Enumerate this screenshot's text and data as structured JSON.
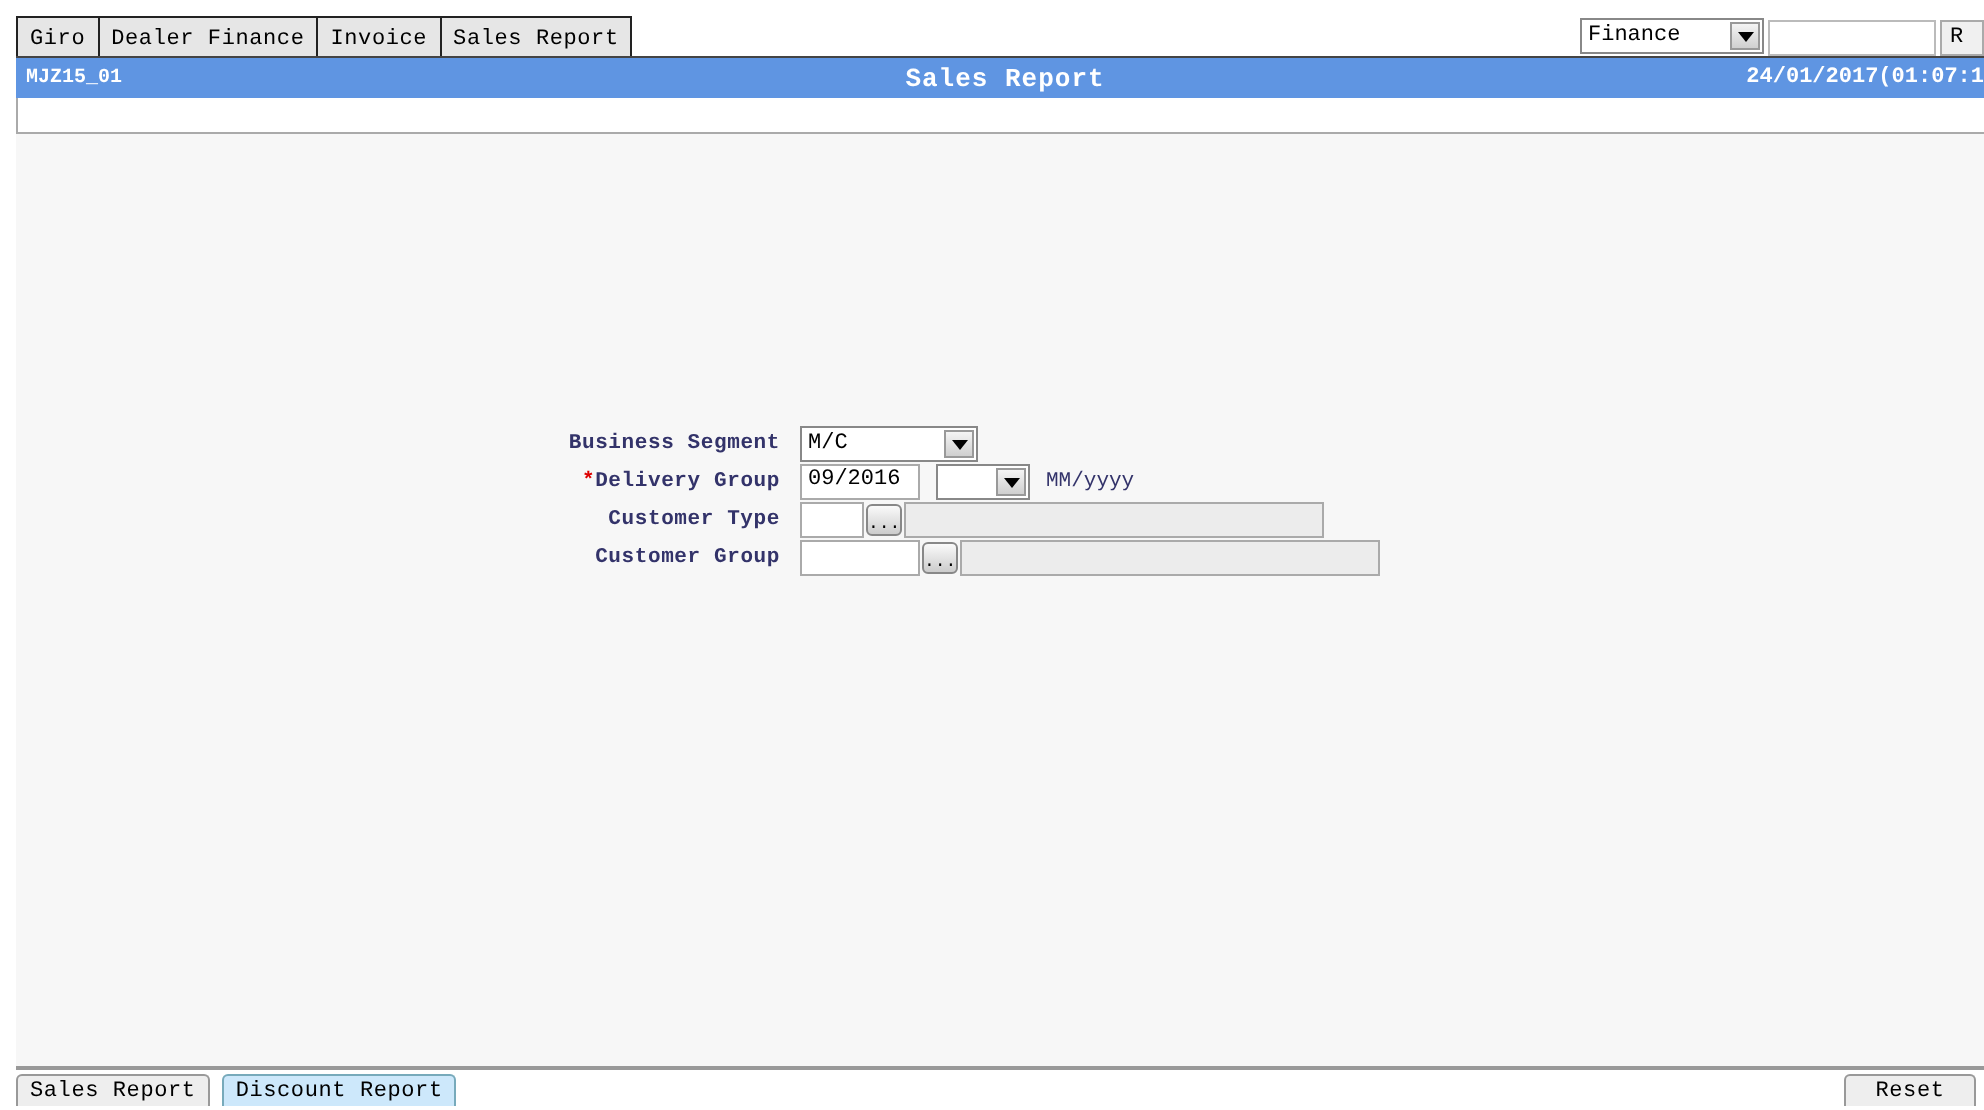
{
  "menu_tabs": [
    {
      "label": "Giro"
    },
    {
      "label": "Dealer Finance"
    },
    {
      "label": "Invoice"
    },
    {
      "label": "Sales Report"
    }
  ],
  "module_select": {
    "value": "Finance"
  },
  "top_button": {
    "label": "R"
  },
  "title_bar": {
    "screen_id": "MJZ15_01",
    "title": "Sales Report",
    "datetime": "24/01/2017(01:07:1"
  },
  "form": [
    {
      "kind": "select",
      "label": "Business Segment",
      "value": "M/C"
    },
    {
      "kind": "date",
      "label": "Delivery Group",
      "required_mark": "*",
      "value": "09/2016",
      "hint": "MM/yyyy"
    },
    {
      "kind": "lookup",
      "label": "Customer Type",
      "button": "..."
    },
    {
      "kind": "wide-lookup",
      "label": "Customer Group",
      "button": "..."
    }
  ],
  "bottom_tabs": [
    {
      "label": "Sales Report",
      "selected": false
    },
    {
      "label": "Discount Report",
      "selected": true
    }
  ],
  "reset_button": {
    "label": "Reset"
  }
}
